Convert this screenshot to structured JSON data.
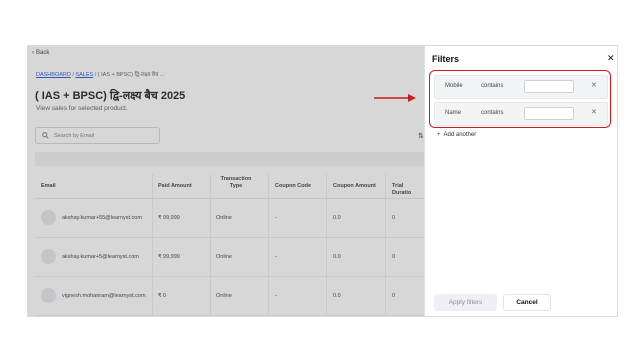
{
  "back_label": "Back",
  "breadcrumb": {
    "items": [
      "DASHBOARD",
      "SALES",
      "( IAS + BPSC) द्वि-लक्ष्य बैच ..."
    ],
    "separator": "/"
  },
  "page": {
    "title": "( IAS + BPSC) द्वि-लक्ष्य बैच 2025",
    "subtitle": "View sales for selected product."
  },
  "search": {
    "placeholder": "Search by Email"
  },
  "table": {
    "headers": [
      "Email",
      "Paid Amount",
      "Transaction Type",
      "Coupon Code",
      "Coupon Amount",
      "Trial Duratio"
    ],
    "rows": [
      {
        "email": "akshay.kumar+55@learnyst.com",
        "paid": "₹ 99,999",
        "type": "Online",
        "coupon": "-",
        "coupon_amount": "0.0",
        "trial": "0"
      },
      {
        "email": "akshay.kumar+5@learnyst.com",
        "paid": "₹ 99,999",
        "type": "Online",
        "coupon": "-",
        "coupon_amount": "0.0",
        "trial": "0"
      },
      {
        "email": "vignesh.mohanram@learnyst.com",
        "paid": "₹ 0",
        "type": "Online",
        "coupon": "-",
        "coupon_amount": "0.0",
        "trial": "0"
      }
    ]
  },
  "filters": {
    "title": "Filters",
    "rows": [
      {
        "field": "Mobile",
        "operator": "contains",
        "value": ""
      },
      {
        "field": "Name",
        "operator": "contains",
        "value": ""
      }
    ],
    "add_label": "Add another",
    "apply_label": "Apply filters",
    "cancel_label": "Cancel"
  },
  "colors": {
    "highlight": "#c81e1e",
    "link": "#1d4ed8"
  }
}
